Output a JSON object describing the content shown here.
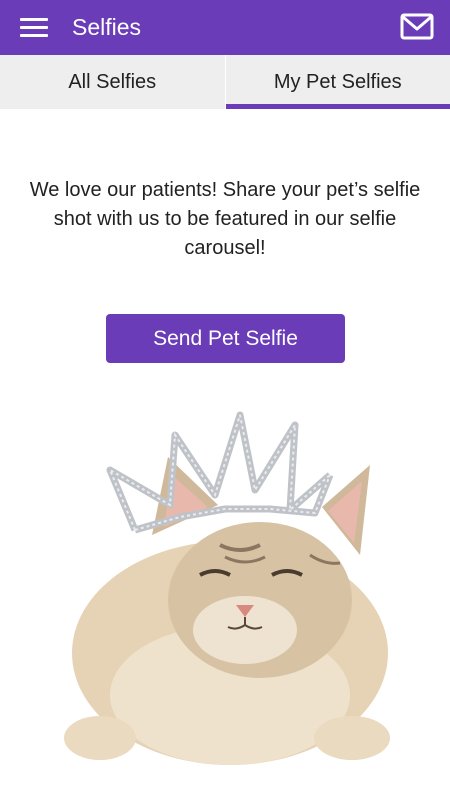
{
  "appbar": {
    "title": "Selfies",
    "menu_icon": "hamburger-menu-icon",
    "mail_icon": "envelope-icon",
    "color": "#6a3cb8"
  },
  "tabs": [
    {
      "label": "All Selfies",
      "active": false
    },
    {
      "label": "My Pet Selfies",
      "active": true
    }
  ],
  "main": {
    "intro_text": "We love our patients! Share your pet’s selfie shot with us to be featured in our selfie carousel!",
    "send_button_label": "Send Pet Selfie",
    "image": "cat-wearing-crown"
  }
}
